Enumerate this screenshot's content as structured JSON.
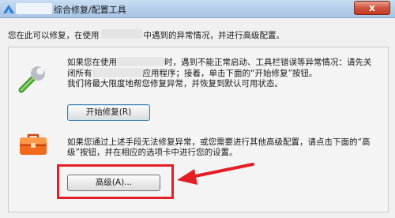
{
  "window": {
    "title": "综合修复/配置工具",
    "close_label": "x"
  },
  "intro": {
    "before": "您在此可以修复，在使用",
    "after": "中遇到的异常情况，并进行高级配置。"
  },
  "repair_section": {
    "line1_a": "如果您在使用",
    "line1_b": "时，遇到不能正常启动、工具栏错误等异常情况：请先关",
    "line2_a": "闭所有",
    "line2_b": "应用程序；接着，单击下面的“开始修复”按钮。",
    "line3": "我们将最大限度地帮您修复异常，并恢复到默认可用状态。",
    "button_label": "开始修复(R)"
  },
  "advanced_section": {
    "line1": "如果您通过上述手段无法修复异常，或您需要进行其他高级配置，请点击下面的“高",
    "line2": "级”按钮，并在相应的选项卡中进行您的设置。",
    "button_label": "高级(A)..."
  },
  "icons": {
    "app": "app-icon",
    "repair": "wrench-icon",
    "advanced": "toolbox-icon"
  },
  "colors": {
    "annotation": "#e41e26",
    "titlebar": "#b4cde9",
    "close_button": "#c2391f"
  }
}
